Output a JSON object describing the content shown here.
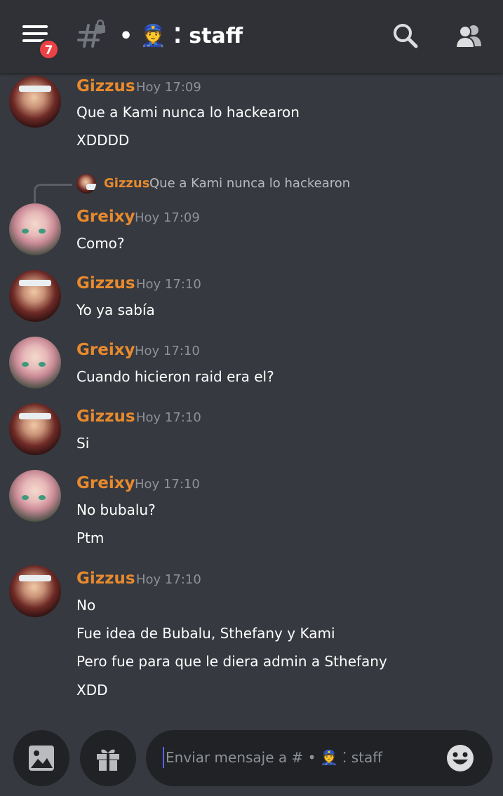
{
  "header": {
    "badge_count": "7",
    "channel_title": "• 👮 ⁚ staff"
  },
  "messages": [
    {
      "author": "Gizzus",
      "time": "Hoy 17:09",
      "lines": [
        "Que a Kami nunca lo hackearon",
        "XDDDD"
      ]
    },
    {
      "reply": {
        "author": "Gizzus",
        "text": "Que a Kami nunca lo hackearon"
      },
      "author": "Greixy",
      "time": "Hoy 17:09",
      "lines": [
        "Como?"
      ]
    },
    {
      "author": "Gizzus",
      "time": "Hoy 17:10",
      "lines": [
        "Yo ya sabía"
      ]
    },
    {
      "author": "Greixy",
      "time": "Hoy 17:10",
      "lines": [
        "Cuando hicieron raid era el?"
      ]
    },
    {
      "author": "Gizzus",
      "time": "Hoy 17:10",
      "lines": [
        "Si"
      ]
    },
    {
      "author": "Greixy",
      "time": "Hoy 17:10",
      "lines": [
        "No bubalu?",
        "Ptm"
      ]
    },
    {
      "author": "Gizzus",
      "time": "Hoy 17:10",
      "lines": [
        "No",
        "Fue idea de Bubalu, Sthefany y Kami",
        "Pero fue para que le diera admin a Sthefany",
        "XDD"
      ]
    }
  ],
  "composer": {
    "placeholder": "Enviar mensaje a # • 👮 ⁚ staff"
  },
  "icons": {
    "menu": "hamburger-menu-icon",
    "channel": "locked-text-channel-icon",
    "search": "search-icon",
    "members": "members-icon",
    "image": "image-icon",
    "gift": "gift-icon",
    "emoji": "emoji-icon"
  },
  "colors": {
    "background": "#36393f",
    "header": "#2f3136",
    "input": "#202225",
    "username": "#e88a2e",
    "badge": "#ed4245",
    "timestamp": "#8e9297"
  }
}
